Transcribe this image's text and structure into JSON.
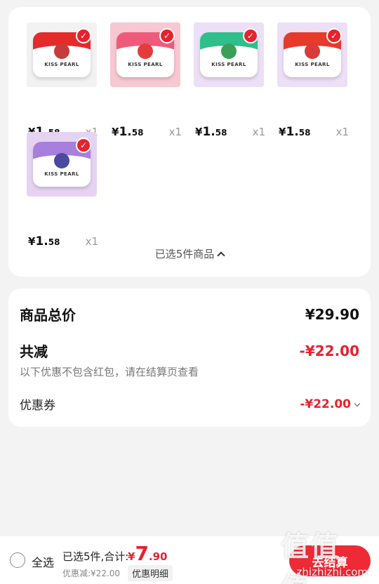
{
  "products": [
    {
      "price_currency": "¥",
      "price_int": "1.",
      "price_dec": "58",
      "qty": "x1",
      "bg": "#f2f2f2",
      "top_color": "#e52a2a",
      "fruit_color": "#c63b3b",
      "brand": "KISS PEARL",
      "icon": "lychee-mint-tin-image"
    },
    {
      "price_currency": "¥",
      "price_int": "1.",
      "price_dec": "58",
      "qty": "x1",
      "bg": "#f7c8d2",
      "top_color": "#f05a7a",
      "fruit_color": "#e33b3b",
      "brand": "KISS PEARL",
      "icon": "strawberry-mint-tin-image"
    },
    {
      "price_currency": "¥",
      "price_int": "1.",
      "price_dec": "58",
      "qty": "x1",
      "bg": "#ecdff6",
      "top_color": "#2fbf8a",
      "fruit_color": "#3aa058",
      "brand": "KISS PEARL",
      "icon": "green-mint-tin-image"
    },
    {
      "price_currency": "¥",
      "price_int": "1.",
      "price_dec": "58",
      "qty": "x1",
      "bg": "#ecdff6",
      "top_color": "#e83a2a",
      "fruit_color": "#d93a3a",
      "brand": "KISS PEARL",
      "icon": "watermelon-mint-tin-image"
    },
    {
      "price_currency": "¥",
      "price_int": "1.",
      "price_dec": "58",
      "qty": "x1",
      "bg": "#e6d3f2",
      "top_color": "#a77fdc",
      "fruit_color": "#4a4aa0",
      "brand": "KISS PEARL",
      "icon": "blueberry-mint-tin-image"
    }
  ],
  "selected_summary": "已选5件商品",
  "summary": {
    "total_label": "商品总价",
    "total_value": "¥29.90",
    "reduce_label": "共减",
    "reduce_value": "-¥22.00",
    "note": "以下优惠不包含红包，请在结算页查看",
    "coupon_label": "优惠券",
    "coupon_value": "-¥22.00"
  },
  "bottom": {
    "select_all": "全选",
    "selected_count": "已选5件,合计:",
    "total_currency": "¥",
    "total_int": "7",
    "total_dec": ".90",
    "discount": "优惠减:¥22.00",
    "detail": "优惠明细",
    "checkout": "去结算"
  },
  "watermark": {
    "big": "值值值",
    "small": "zhizhizhi.com"
  },
  "colors": {
    "accent": "#e8222f"
  }
}
